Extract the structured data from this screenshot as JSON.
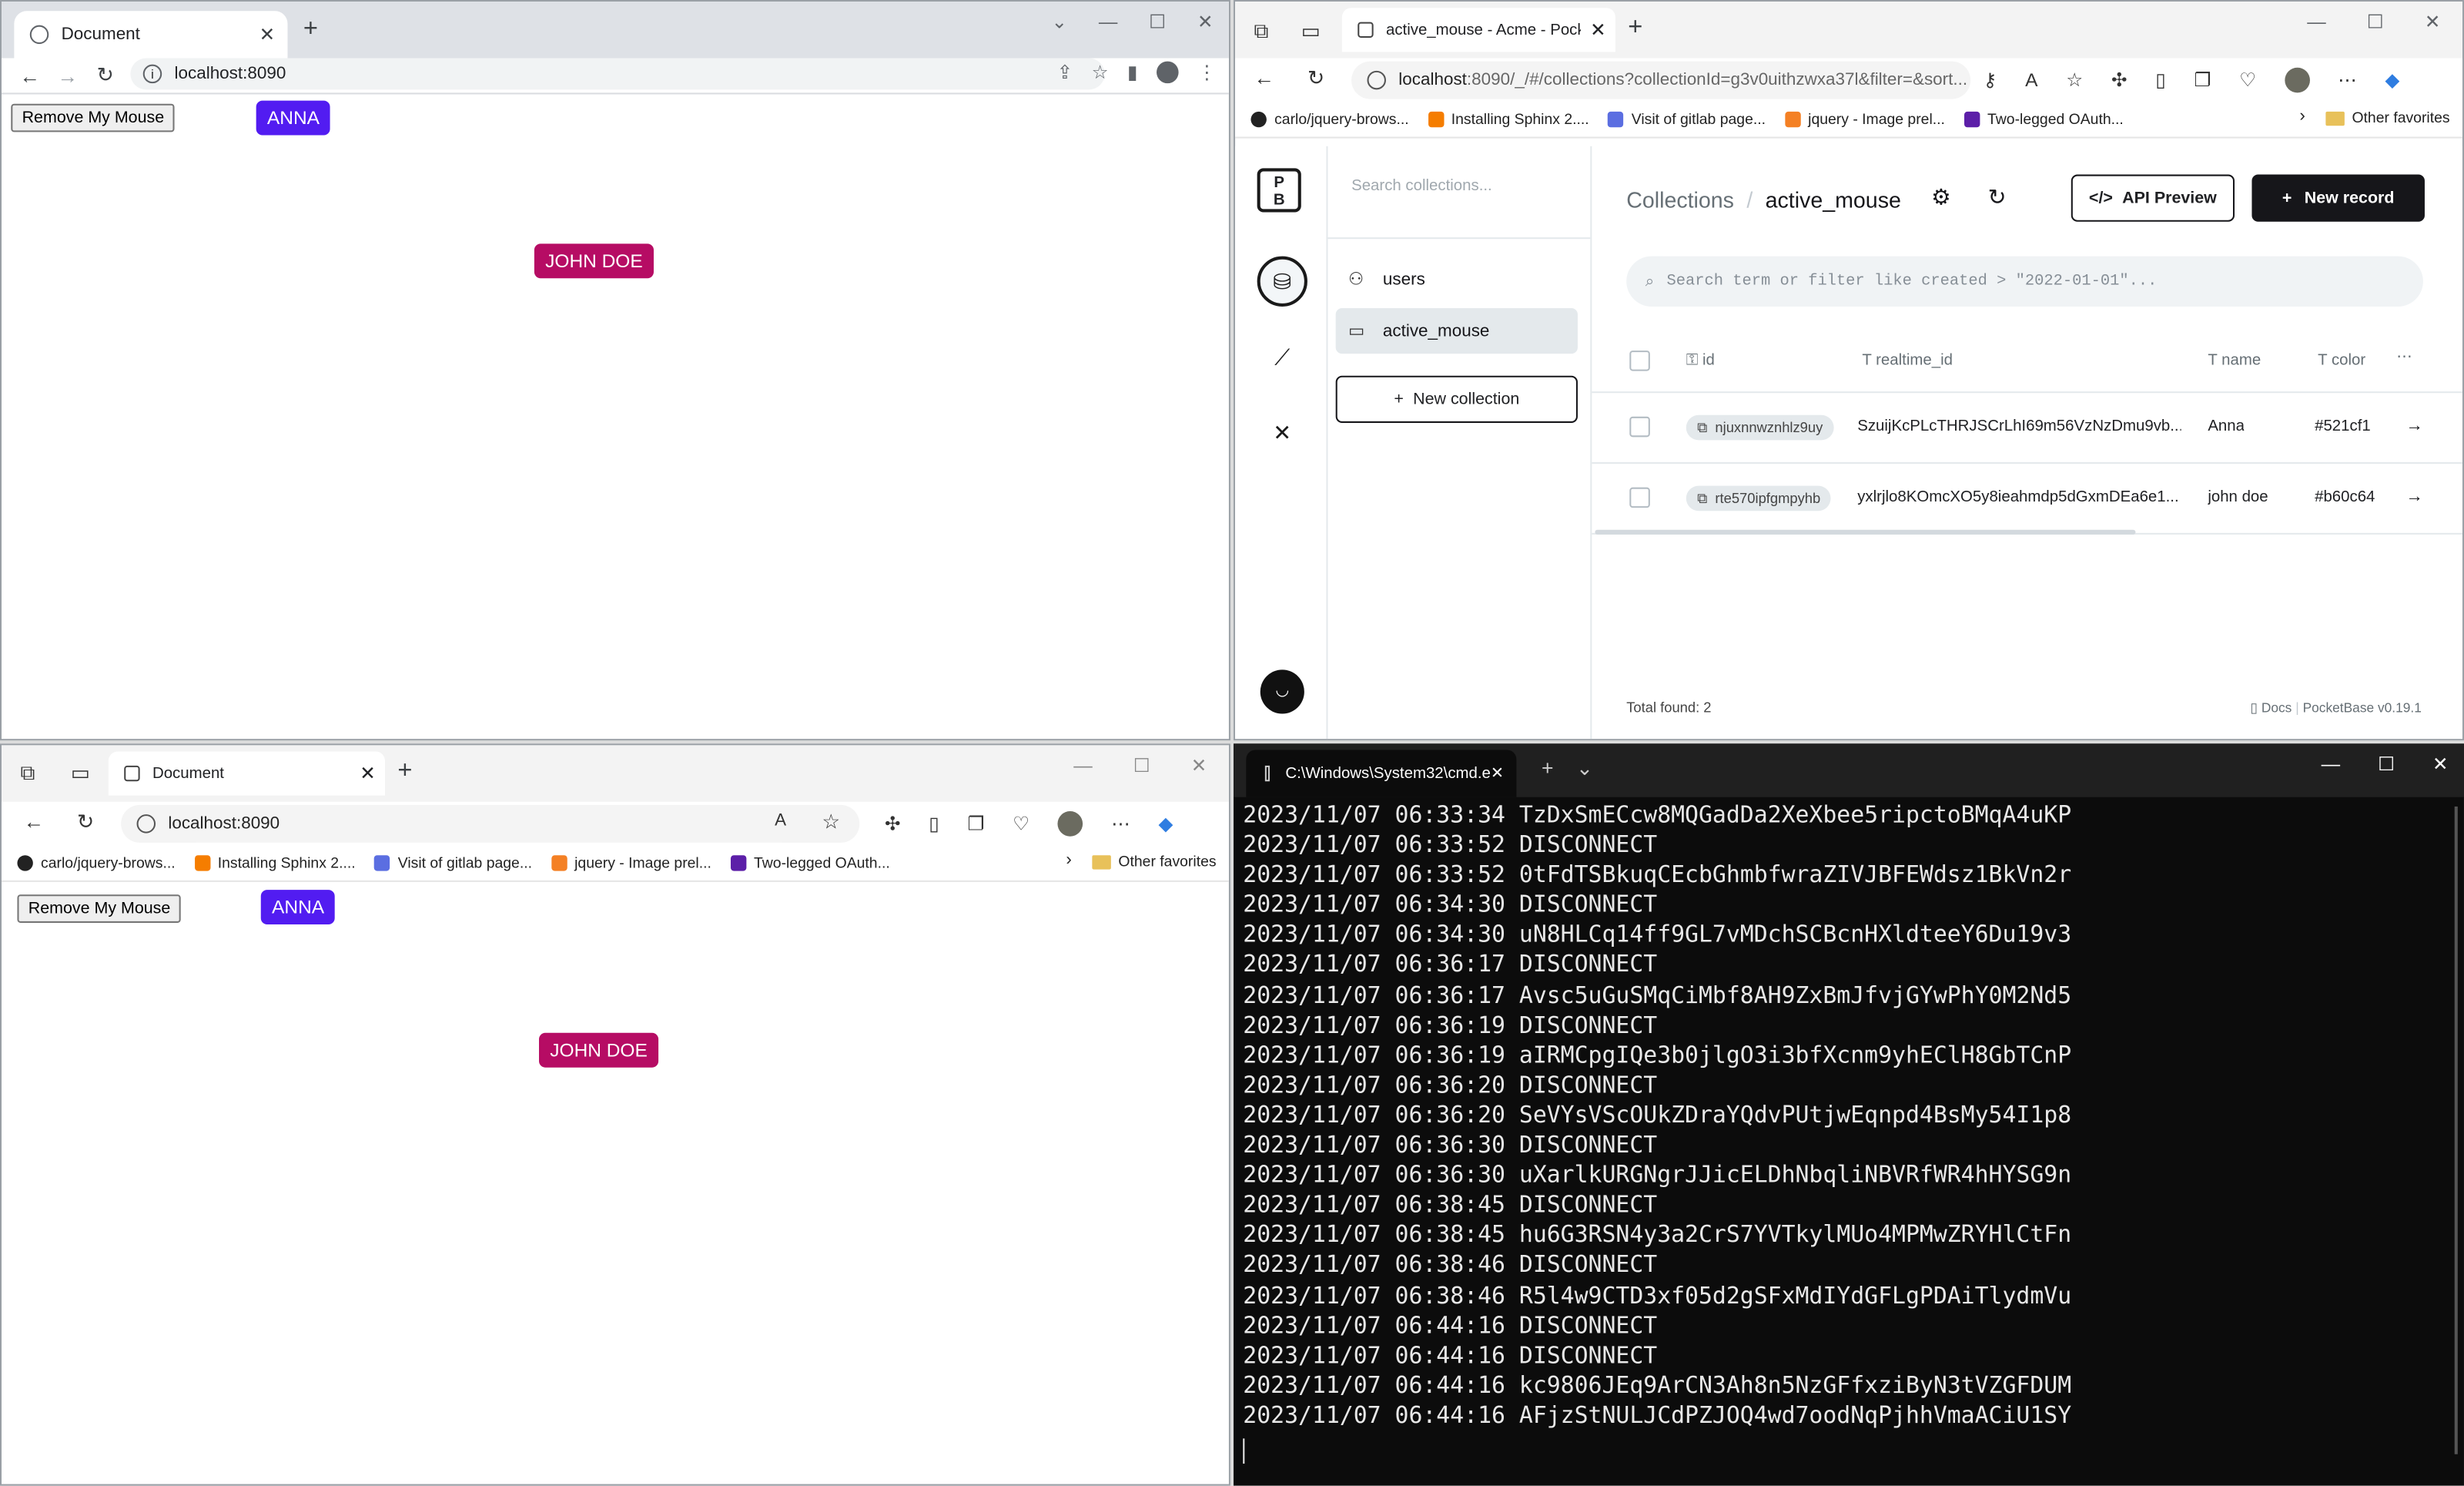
{
  "chrome_window": {
    "tab_title": "Document",
    "url": "localhost:8090",
    "remove_button": "Remove My Mouse",
    "anna_label": "ANNA",
    "john_label": "JOHN DOE"
  },
  "edge_pocketbase": {
    "tab_title": "active_mouse - Acme - PocketBa",
    "url_host": "localhost",
    "url_rest": ":8090/_/#/collections?collectionId=g3v0uithzwxa37l&filter=&sort...",
    "bookmarks": [
      "carlo/jquery-brows...",
      "Installing Sphinx 2....",
      "Visit of gitlab page...",
      "jquery - Image prel...",
      "Two-legged OAuth..."
    ],
    "other_favorites": "Other favorites",
    "search_collections_placeholder": "Search collections...",
    "collections": [
      "users",
      "active_mouse"
    ],
    "new_collection": "New collection",
    "breadcrumb_root": "Collections",
    "breadcrumb_current": "active_mouse",
    "api_preview": "API Preview",
    "new_record": "New record",
    "filter_placeholder": "Search term or filter like created > \"2022-01-01\"...",
    "columns": [
      "id",
      "realtime_id",
      "name",
      "color"
    ],
    "rows": [
      {
        "id": "njuxnnwznhlz9uy",
        "realtime_id": "SzuijKcPLcTHRJSCrLhI69m56VzNzDmu9vb...",
        "name": "Anna",
        "color": "#521cf1"
      },
      {
        "id": "rte570ipfgmpyhb",
        "realtime_id": "yxlrjlo8KOmcXO5y8ieahmdp5dGxmDEa6e1...",
        "name": "john doe",
        "color": "#b60c64"
      }
    ],
    "total_found": "Total found: 2",
    "docs": "Docs",
    "version": "PocketBase v0.19.1"
  },
  "edge_bottom": {
    "tab_title": "Document",
    "url": "localhost:8090",
    "bookmarks": [
      "carlo/jquery-brows...",
      "Installing Sphinx 2....",
      "Visit of gitlab page...",
      "jquery - Image prel...",
      "Two-legged OAuth..."
    ],
    "other_favorites": "Other favorites",
    "remove_button": "Remove My Mouse",
    "anna_label": "ANNA",
    "john_label": "JOHN DOE"
  },
  "terminal": {
    "tab_title": "C:\\Windows\\System32\\cmd.e",
    "lines": [
      "2023/11/07 06:33:34 TzDxSmECcw8MQGadDa2XeXbee5ripctoBMqA4uKP",
      "2023/11/07 06:33:52 DISCONNECT",
      "2023/11/07 06:33:52 0tFdTSBkuqCEcbGhmbfwraZIVJBFEWdsz1BkVn2r",
      "2023/11/07 06:34:30 DISCONNECT",
      "2023/11/07 06:34:30 uN8HLCq14ff9GL7vMDchSCBcnHXldteeY6Du19v3",
      "2023/11/07 06:36:17 DISCONNECT",
      "2023/11/07 06:36:17 Avsc5uGuSMqCiMbf8AH9ZxBmJfvjGYwPhY0M2Nd5",
      "2023/11/07 06:36:19 DISCONNECT",
      "2023/11/07 06:36:19 aIRMCpgIQe3b0jlgO3i3bfXcnm9yhEClH8GbTCnP",
      "2023/11/07 06:36:20 DISCONNECT",
      "2023/11/07 06:36:20 SeVYsVScOUkZDraYQdvPUtjwEqnpd4BsMy54I1p8",
      "2023/11/07 06:36:30 DISCONNECT",
      "2023/11/07 06:36:30 uXarlkURGNgrJJicELDhNbqliNBVRfWR4hHYSG9n",
      "2023/11/07 06:38:45 DISCONNECT",
      "2023/11/07 06:38:45 hu6G3RSN4y3a2CrS7YVTkylMUo4MPMwZRYHlCtFn",
      "2023/11/07 06:38:46 DISCONNECT",
      "2023/11/07 06:38:46 R5l4w9CTD3xf05d2gSFxMdIYdGFLgPDAiTlydmVu",
      "2023/11/07 06:44:16 DISCONNECT",
      "2023/11/07 06:44:16 DISCONNECT",
      "2023/11/07 06:44:16 kc9806JEq9ArCN3Ah8n5NzGFfxziByN3tVZGFDUM",
      "2023/11/07 06:44:16 AFjzStNULJCdPZJOQ4wd7oodNqPjhhVmaACiU1SY"
    ]
  }
}
